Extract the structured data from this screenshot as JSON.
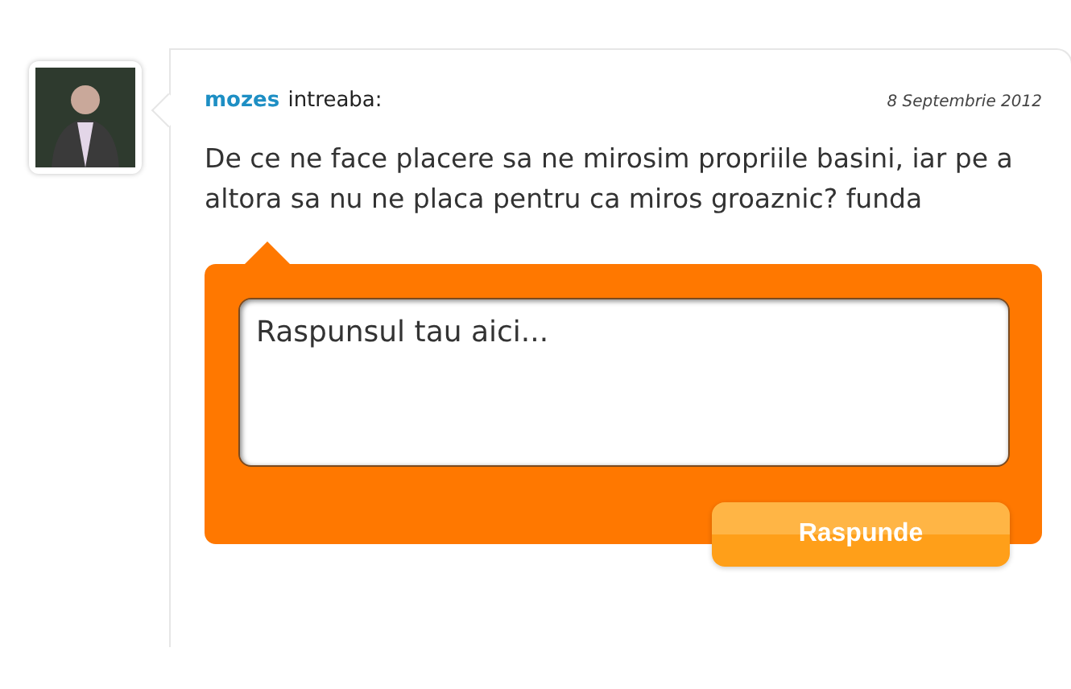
{
  "question": {
    "author": "mozes",
    "verb": "intreaba:",
    "date": "8 Septembrie 2012",
    "text": "De ce ne face placere sa ne mirosim propriile basini, iar pe a altora sa nu ne placa pentru ca miros groaznic? funda"
  },
  "answer_form": {
    "placeholder": "Raspunsul tau aici...",
    "button": "Raspunde"
  }
}
